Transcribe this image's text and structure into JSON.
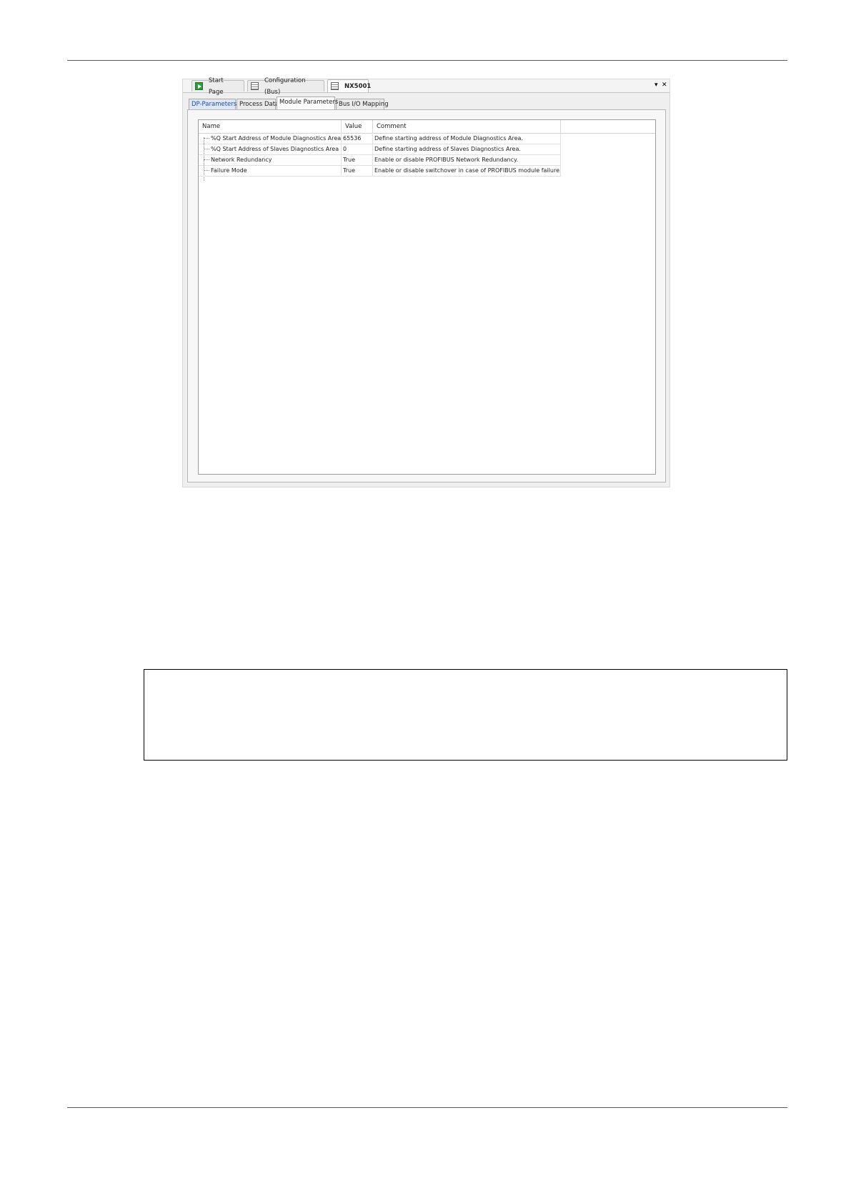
{
  "doc_tabs": [
    {
      "label": "Start Page"
    },
    {
      "label": "Configuration (Bus)"
    },
    {
      "label": "NX5001"
    }
  ],
  "window_controls": {
    "pin": "▾",
    "close": "✕"
  },
  "sub_tabs": [
    {
      "label": "DP-Parameters"
    },
    {
      "label": "Process Data"
    },
    {
      "label": "Module Parameters"
    },
    {
      "label": "Bus I/O Mapping"
    }
  ],
  "grid": {
    "headers": {
      "name": "Name",
      "value": "Value",
      "comment": "Comment"
    },
    "rows": [
      {
        "name": "%Q Start Address of Module Diagnostics Area",
        "value": "65536",
        "comment": "Define starting address of Module Diagnostics Area."
      },
      {
        "name": "%Q Start Address of Slaves Diagnostics Area",
        "value": "0",
        "comment": "Define starting address of Slaves Diagnostics Area."
      },
      {
        "name": "Network Redundancy",
        "value": "True",
        "comment": "Enable or disable PROFIBUS Network Redundancy."
      },
      {
        "name": "Failure Mode",
        "value": "True",
        "comment": "Enable or disable switchover in case of PROFIBUS module failure."
      }
    ]
  },
  "icons": {
    "start_page_tab": "start-page-icon",
    "config_tab": "sheet-icon",
    "nx_tab": "sheet-icon"
  }
}
